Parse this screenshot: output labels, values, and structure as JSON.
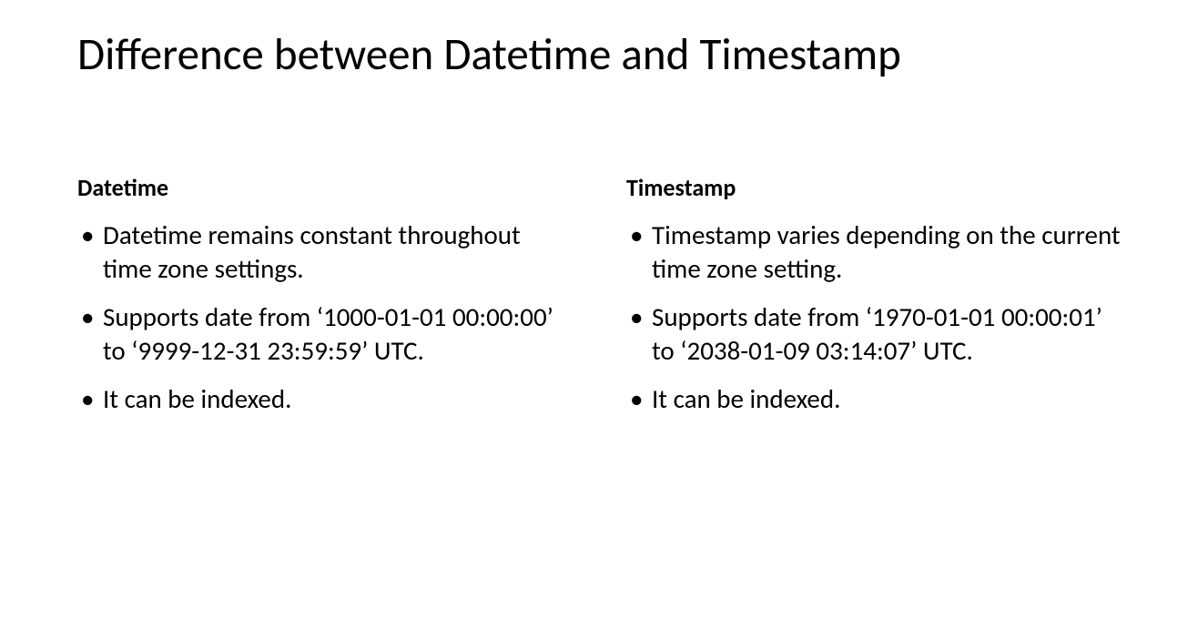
{
  "title": "Difference between Datetime and Timestamp",
  "columns": [
    {
      "heading": "Datetime",
      "bullets": [
        "Datetime remains constant throughout time zone settings.",
        "Supports date from ‘1000-01-01 00:00:00’ to ‘9999-12-31 23:59:59’ UTC.",
        "It can be indexed."
      ]
    },
    {
      "heading": "Timestamp",
      "bullets": [
        "Timestamp varies depending on the current time zone setting.",
        "Supports date from ‘1970-01-01 00:00:01’ to ‘2038-01-09 03:14:07’ UTC.",
        "It can be indexed."
      ]
    }
  ]
}
